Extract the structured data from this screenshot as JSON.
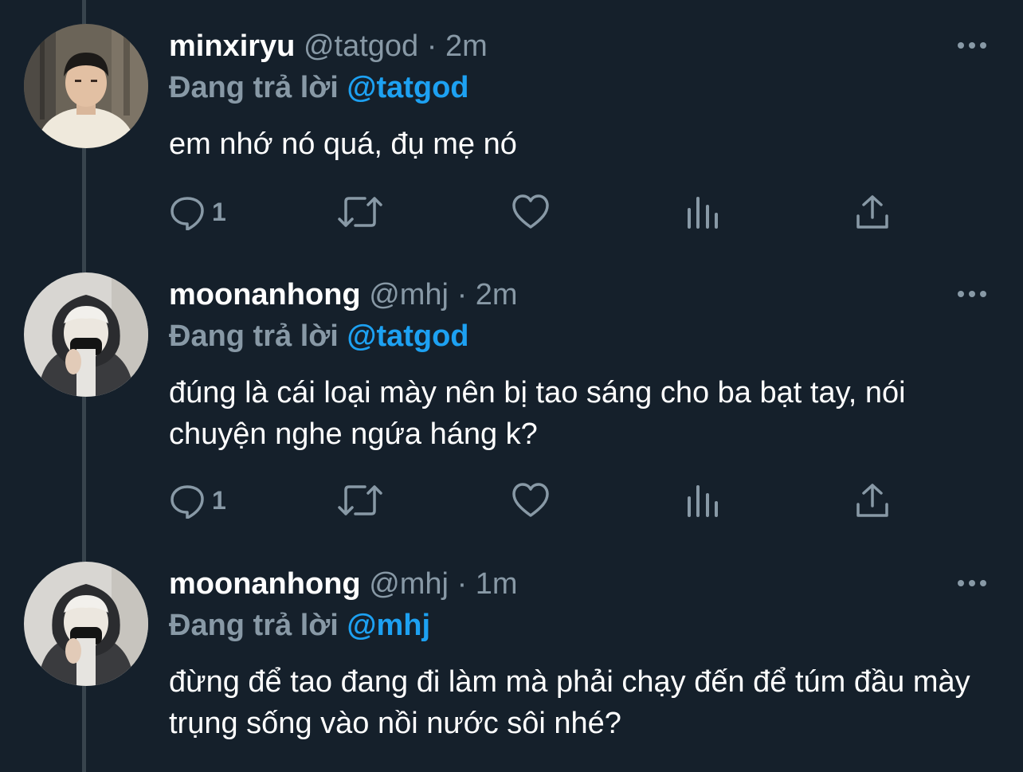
{
  "colors": {
    "background": "#15202b",
    "muted": "#8899a6",
    "accent": "#1da1f2",
    "thread_line": "#38444d"
  },
  "tweets": [
    {
      "display_name": "minxiryu",
      "handle": "@tatgod",
      "separator": "·",
      "time": "2m",
      "reply_prefix": "Đang trả lời",
      "reply_to": "@tatgod",
      "text": "em nhớ nó quá, đụ mẹ nó",
      "reply_count": "1",
      "avatar": "avatar-photo"
    },
    {
      "display_name": "moonanhong",
      "handle": "@mhj",
      "separator": "·",
      "time": "2m",
      "reply_prefix": "Đang trả lời",
      "reply_to": "@tatgod",
      "text": "đúng là cái loại mày nên bị tao sáng cho ba bạt tay, nói chuyện nghe ngứa háng k?",
      "reply_count": "1",
      "avatar": "avatar-photo"
    },
    {
      "display_name": "moonanhong",
      "handle": "@mhj",
      "separator": "·",
      "time": "1m",
      "reply_prefix": "Đang trả lời",
      "reply_to": "@mhj",
      "text": "đừng để tao đang đi làm mà phải chạy đến để túm đầu mày trụng sống vào nồi nước sôi nhé?",
      "avatar": "avatar-photo"
    }
  ],
  "icons": [
    "more-icon",
    "reply-icon",
    "retweet-icon",
    "like-icon",
    "analytics-icon",
    "share-icon"
  ]
}
